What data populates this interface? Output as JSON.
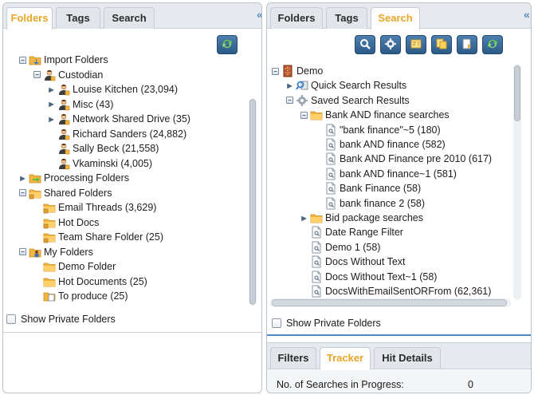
{
  "left": {
    "tabs": [
      {
        "label": "Folders",
        "active": true
      },
      {
        "label": "Tags",
        "active": false
      },
      {
        "label": "Search",
        "active": false
      }
    ],
    "collapse": "«",
    "tree": [
      {
        "label": "Import Folders",
        "depth": 0,
        "toggle": "minus",
        "icon": "import-folder"
      },
      {
        "label": "Custodian",
        "depth": 1,
        "toggle": "minus",
        "icon": "person"
      },
      {
        "label": "Louise Kitchen (23,094)",
        "depth": 2,
        "toggle": "tri",
        "icon": "person"
      },
      {
        "label": "Misc (43)",
        "depth": 2,
        "toggle": "tri",
        "icon": "person"
      },
      {
        "label": "Network Shared Drive (35)",
        "depth": 2,
        "toggle": "tri",
        "icon": "person"
      },
      {
        "label": "Richard Sanders (24,882)",
        "depth": 2,
        "toggle": "none",
        "icon": "person"
      },
      {
        "label": "Sally Beck (21,558)",
        "depth": 2,
        "toggle": "none",
        "icon": "person"
      },
      {
        "label": "Vkaminski (4,005)",
        "depth": 2,
        "toggle": "none",
        "icon": "person"
      },
      {
        "label": "Processing Folders",
        "depth": 0,
        "toggle": "tri",
        "icon": "processing-folder"
      },
      {
        "label": "Shared Folders",
        "depth": 0,
        "toggle": "minus",
        "icon": "shared-folder"
      },
      {
        "label": "Email Threads (3,629)",
        "depth": 1,
        "toggle": "none",
        "icon": "shared-folder"
      },
      {
        "label": "Hot Docs",
        "depth": 1,
        "toggle": "none",
        "icon": "shared-folder"
      },
      {
        "label": "Team Share Folder (25)",
        "depth": 1,
        "toggle": "none",
        "icon": "shared-folder"
      },
      {
        "label": "My Folders",
        "depth": 0,
        "toggle": "minus",
        "icon": "my-folder"
      },
      {
        "label": "Demo Folder",
        "depth": 1,
        "toggle": "none",
        "icon": "folder"
      },
      {
        "label": "Hot Documents (25)",
        "depth": 1,
        "toggle": "none",
        "icon": "folder"
      },
      {
        "label": "To produce (25)",
        "depth": 1,
        "toggle": "none",
        "icon": "folder-doc"
      }
    ],
    "show_private": "Show Private Folders"
  },
  "right": {
    "tabs": [
      {
        "label": "Folders",
        "active": false
      },
      {
        "label": "Tags",
        "active": false
      },
      {
        "label": "Search",
        "active": true
      }
    ],
    "collapse": "«",
    "tree": [
      {
        "label": "Demo",
        "depth": 0,
        "toggle": "minus",
        "icon": "cabinet"
      },
      {
        "label": "Quick Search Results",
        "depth": 1,
        "toggle": "tri",
        "icon": "quick-search"
      },
      {
        "label": "Saved Search Results",
        "depth": 1,
        "toggle": "minus",
        "icon": "saved-search"
      },
      {
        "label": "Bank AND finance searches",
        "depth": 2,
        "toggle": "minus",
        "icon": "folder"
      },
      {
        "label": "\"bank finance\"~5 (180)",
        "depth": 3,
        "toggle": "none",
        "icon": "search-doc"
      },
      {
        "label": "bank AND finance (582)",
        "depth": 3,
        "toggle": "none",
        "icon": "search-doc"
      },
      {
        "label": "Bank AND Finance pre 2010 (617)",
        "depth": 3,
        "toggle": "none",
        "icon": "search-doc"
      },
      {
        "label": "bank AND finance~1 (581)",
        "depth": 3,
        "toggle": "none",
        "icon": "search-doc"
      },
      {
        "label": "Bank Finance (58)",
        "depth": 3,
        "toggle": "none",
        "icon": "search-doc"
      },
      {
        "label": "bank finance 2 (58)",
        "depth": 3,
        "toggle": "none",
        "icon": "search-doc"
      },
      {
        "label": "Bid package searches",
        "depth": 2,
        "toggle": "tri",
        "icon": "folder"
      },
      {
        "label": "Date Range Filter",
        "depth": 2,
        "toggle": "none",
        "icon": "search-doc"
      },
      {
        "label": "Demo 1 (58)",
        "depth": 2,
        "toggle": "none",
        "icon": "search-doc"
      },
      {
        "label": "Docs Without Text",
        "depth": 2,
        "toggle": "none",
        "icon": "search-doc"
      },
      {
        "label": "Docs Without Text~1 (58)",
        "depth": 2,
        "toggle": "none",
        "icon": "search-doc"
      },
      {
        "label": "DocsWithEmailSentORFrom (62,361)",
        "depth": 2,
        "toggle": "none",
        "icon": "search-doc"
      }
    ],
    "show_private": "Show Private Folders",
    "bottom_tabs": [
      {
        "label": "Filters",
        "active": false
      },
      {
        "label": "Tracker",
        "active": true
      },
      {
        "label": "Hit Details",
        "active": false
      }
    ],
    "tracker": {
      "label": "No. of Searches in Progress:",
      "value": "0"
    }
  },
  "colors": {
    "active_tab": "#e8a526",
    "toolbar_button": "#3a6795",
    "folder": "#f2b640"
  }
}
